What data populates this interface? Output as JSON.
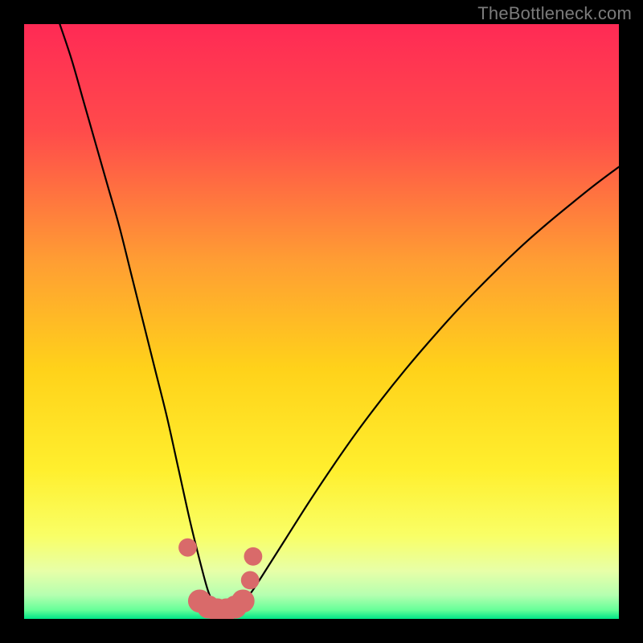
{
  "attribution": "TheBottleneck.com",
  "colors": {
    "background_black": "#000000",
    "gradient_stops": [
      {
        "offset": "0%",
        "color": "#ff2a55"
      },
      {
        "offset": "18%",
        "color": "#ff4b4b"
      },
      {
        "offset": "40%",
        "color": "#ff9e33"
      },
      {
        "offset": "58%",
        "color": "#ffd21a"
      },
      {
        "offset": "75%",
        "color": "#ffef2e"
      },
      {
        "offset": "86%",
        "color": "#f9ff66"
      },
      {
        "offset": "92%",
        "color": "#e7ffa8"
      },
      {
        "offset": "96%",
        "color": "#b5ffb0"
      },
      {
        "offset": "98.5%",
        "color": "#66ff99"
      },
      {
        "offset": "100%",
        "color": "#00e588"
      }
    ],
    "curve_stroke": "#000000",
    "marker_fill": "#d96a6a"
  },
  "chart_data": {
    "type": "line",
    "title": "",
    "xlabel": "",
    "ylabel": "",
    "xlim": [
      0,
      100
    ],
    "ylim": [
      0,
      100
    ],
    "grid": false,
    "legend": false,
    "comment": "Values are read off the rendered curve; x is horizontal position (% of plot width from left), y is bottleneck percentage (0 = bottom/green, 100 = top/red). Curve enters top-left, dips to ~0 near x≈33, rises toward top-right.",
    "series": [
      {
        "name": "bottleneck-curve",
        "x": [
          6,
          8,
          10,
          12,
          14,
          16,
          18,
          20,
          22,
          24,
          26,
          28,
          30,
          31,
          32,
          33,
          34,
          35,
          36,
          38,
          40,
          44,
          48,
          52,
          56,
          60,
          64,
          68,
          72,
          76,
          80,
          84,
          88,
          92,
          96,
          100
        ],
        "y": [
          100,
          94,
          87,
          80,
          73,
          66,
          58,
          50,
          42,
          34,
          25,
          16,
          8,
          4.5,
          2.3,
          1.2,
          1.0,
          1.3,
          2.0,
          4.2,
          7.2,
          13.5,
          19.8,
          25.8,
          31.5,
          36.8,
          41.8,
          46.5,
          51.0,
          55.2,
          59.2,
          63.0,
          66.5,
          69.8,
          73.0,
          76.0
        ]
      }
    ],
    "markers": {
      "comment": "Salmon dots near the curve bottom (rounded-rect cluster).",
      "points": [
        {
          "x": 27.5,
          "y": 12.0,
          "r": 1.0
        },
        {
          "x": 29.5,
          "y": 3.0,
          "r": 1.4
        },
        {
          "x": 31.0,
          "y": 2.0,
          "r": 1.4
        },
        {
          "x": 32.5,
          "y": 1.5,
          "r": 1.4
        },
        {
          "x": 34.0,
          "y": 1.5,
          "r": 1.4
        },
        {
          "x": 35.5,
          "y": 2.0,
          "r": 1.4
        },
        {
          "x": 36.8,
          "y": 3.0,
          "r": 1.4
        },
        {
          "x": 38.0,
          "y": 6.5,
          "r": 1.0
        },
        {
          "x": 38.5,
          "y": 10.5,
          "r": 1.0
        }
      ]
    }
  }
}
